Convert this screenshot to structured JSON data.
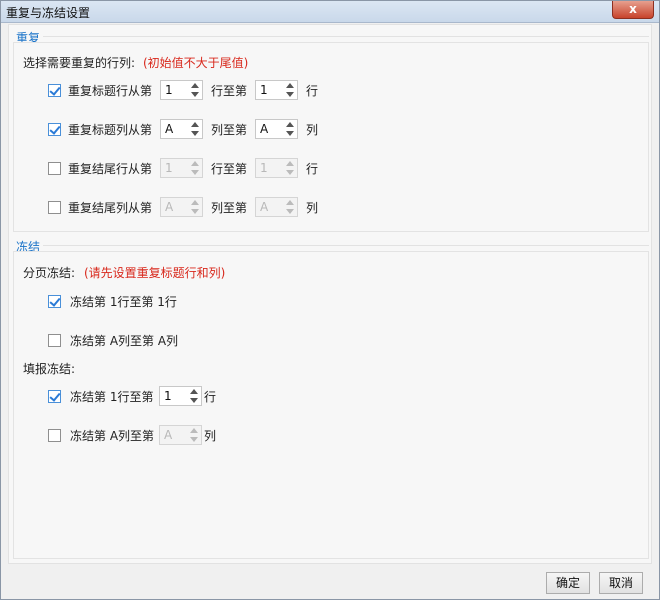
{
  "window": {
    "title": "重复与冻结设置",
    "close_glyph": "x"
  },
  "repeat": {
    "section_title": "重复",
    "prompt_label": "选择需要重复的行列:",
    "prompt_hint": "(初始值不大于尾值)",
    "rows": [
      {
        "checked": true,
        "label": "重复标题行从第",
        "from": "1",
        "mid": "行至第",
        "to": "1",
        "suffix": "行",
        "disabled": false
      },
      {
        "checked": true,
        "label": "重复标题列从第",
        "from": "A",
        "mid": "列至第",
        "to": "A",
        "suffix": "列",
        "disabled": false
      },
      {
        "checked": false,
        "label": "重复结尾行从第",
        "from": "1",
        "mid": "行至第",
        "to": "1",
        "suffix": "行",
        "disabled": true
      },
      {
        "checked": false,
        "label": "重复结尾列从第",
        "from": "A",
        "mid": "列至第",
        "to": "A",
        "suffix": "列",
        "disabled": true
      }
    ]
  },
  "freeze": {
    "section_title": "冻结",
    "paging_label": "分页冻结:",
    "paging_hint": "(请先设置重复标题行和列)",
    "paging_rows": [
      {
        "checked": true,
        "label": "冻结第 1行至第 1行"
      },
      {
        "checked": false,
        "label": "冻结第 A列至第 A列"
      }
    ],
    "fill_label": "填报冻结:",
    "fill_rows": [
      {
        "checked": true,
        "label": "冻结第 1行至第",
        "value": "1",
        "suffix": "行",
        "disabled": false
      },
      {
        "checked": false,
        "label": "冻结第 A列至第",
        "value": "A",
        "suffix": "列",
        "disabled": true
      }
    ]
  },
  "footer": {
    "ok_label": "确定",
    "cancel_label": "取消"
  }
}
